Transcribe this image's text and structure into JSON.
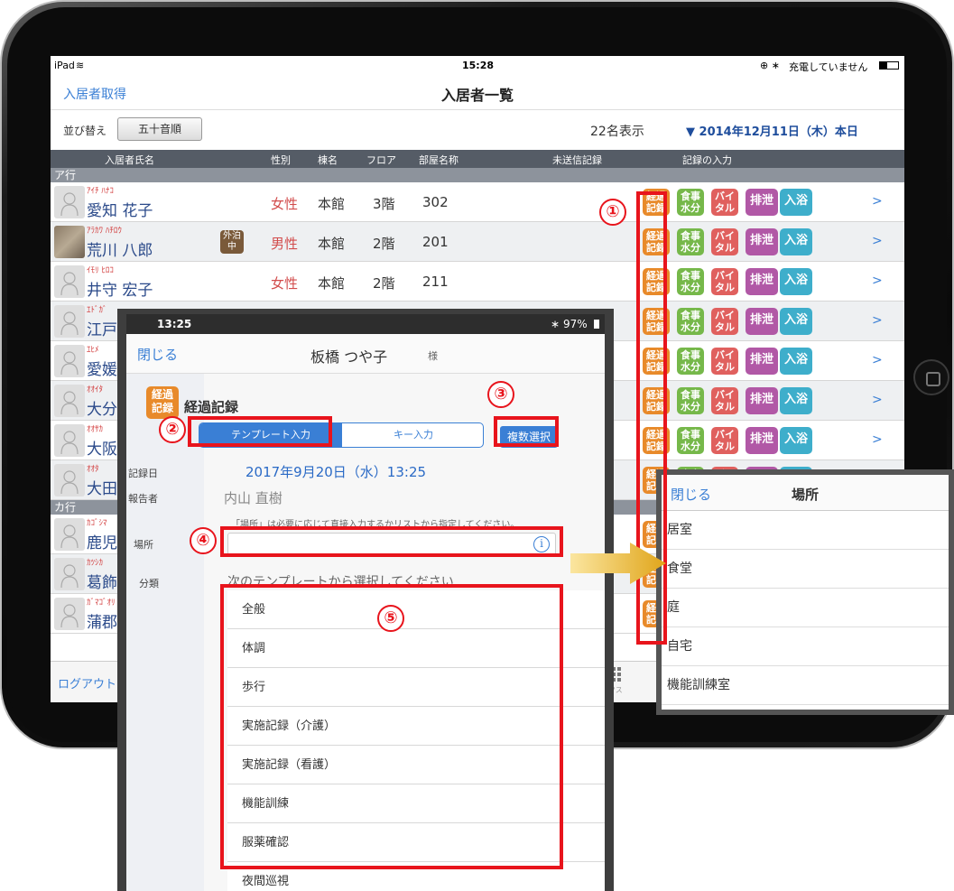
{
  "status": {
    "device": "iPad",
    "time": "15:28",
    "battery": "充電していません"
  },
  "nav": {
    "left": "入居者取得",
    "title": "入居者一覧"
  },
  "sort": {
    "label": "並び替え",
    "button": "五十音順",
    "count": "22名表示",
    "date": "▼ 2014年12月11日（木）本日"
  },
  "columns": {
    "name": "入居者氏名",
    "gender": "性別",
    "bldg": "棟名",
    "floor": "フロア",
    "room": "部屋名称",
    "unsent": "未送信記録",
    "input": "記録の入力"
  },
  "sections": {
    "a": "ア行",
    "ka": "カ行"
  },
  "buttons": {
    "keika": "経過記録",
    "meal": "食事水分",
    "vital": "バイタル",
    "excr": "排泄",
    "bath": "入浴",
    "chev": ">"
  },
  "residents": [
    {
      "kana": "ｱｲﾁ ﾊﾅｺ",
      "name": "愛知 花子",
      "gender": "女性",
      "bldg": "本館",
      "floor": "3階",
      "room": "302"
    },
    {
      "kana": "ｱﾗｶﾜ ﾊﾁﾛｳ",
      "name": "荒川 八郎",
      "gender": "男性",
      "bldg": "本館",
      "floor": "2階",
      "room": "201",
      "badge": "外泊中"
    },
    {
      "kana": "ｲﾓﾘ ﾋﾛｺ",
      "name": "井守 宏子",
      "gender": "女性",
      "bldg": "本館",
      "floor": "2階",
      "room": "211"
    },
    {
      "kana": "ｴﾄﾞｶﾞ",
      "name": "江戸"
    },
    {
      "kana": "ｴﾋﾒ",
      "name": "愛媛"
    },
    {
      "kana": "ｵｵｲﾀ",
      "name": "大分"
    },
    {
      "kana": "ｵｵｻｶ",
      "name": "大阪"
    },
    {
      "kana": "ｵｵﾀ",
      "name": "大田"
    },
    {
      "kana": "ｶｺﾞｼﾏ",
      "name": "鹿児"
    },
    {
      "kana": "ｶﾂｼｶ",
      "name": "葛飾"
    },
    {
      "kana": "ｶﾞﾏｺﾞｵﾘ",
      "name": "蒲郡"
    }
  ],
  "footer": {
    "logout": "ログアウト",
    "tab": "ックス"
  },
  "dialog": {
    "time": "13:25",
    "battery": "97%",
    "close": "閉じる",
    "patient": "板橋 つや子",
    "sama": "様",
    "icon": "経過記録",
    "heading": "経過記録",
    "seg_template": "テンプレート入力",
    "seg_key": "キー入力",
    "multi": "複数選択",
    "date_label": "記録日",
    "date_value": "2017年9月20日（水）13:25",
    "reporter_label": "報告者",
    "reporter_value": "内山 直樹",
    "hint": "「場所」は必要に応じて直接入力するかリストから指定してください。",
    "place_label": "場所",
    "class_label": "分類",
    "template_hint": "次のテンプレートから選択してください",
    "templates": [
      "全般",
      "体調",
      "歩行",
      "実施記録（介護）",
      "実施記録（看護）",
      "機能訓練",
      "服薬確認",
      "夜間巡視"
    ]
  },
  "picker": {
    "close": "閉じる",
    "title": "場所",
    "items": [
      "居室",
      "食堂",
      "庭",
      "自宅",
      "機能訓練室"
    ]
  },
  "annotations": {
    "n1": "①",
    "n2": "②",
    "n3": "③",
    "n4": "④",
    "n5": "⑤"
  },
  "colors": {
    "accent": "#3a7fd5",
    "keika": "#e88a2a",
    "meal": "#76b84a",
    "vital": "#e0605e",
    "excr": "#b158a6",
    "bath": "#3eaecb",
    "annotation": "#e8141c"
  }
}
